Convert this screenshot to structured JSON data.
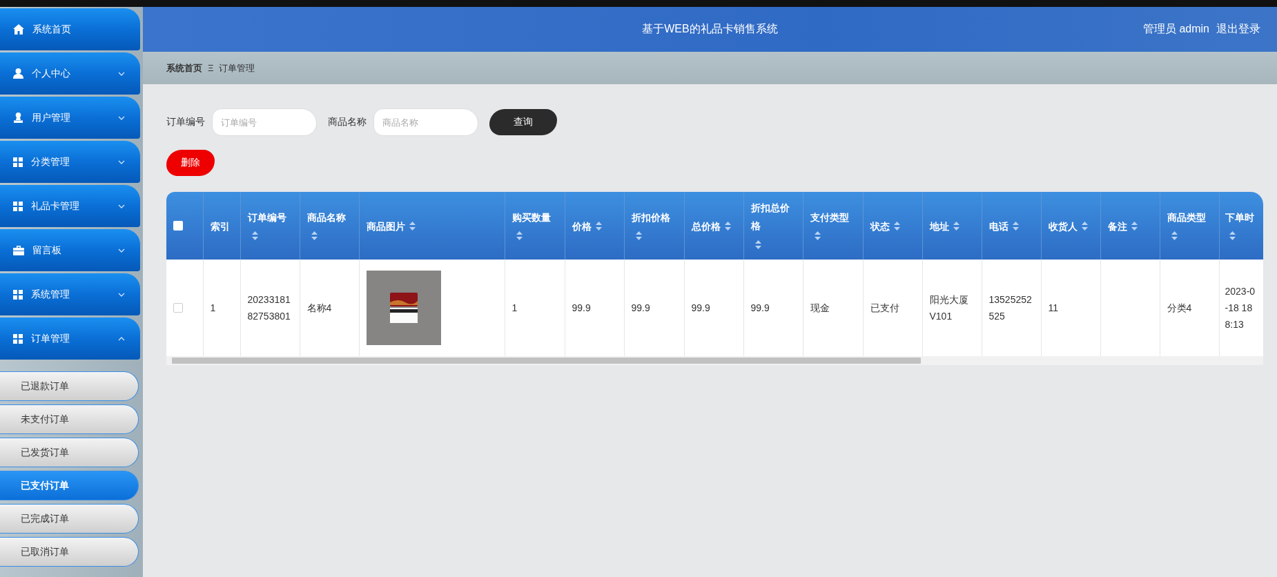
{
  "sidebar": {
    "items": [
      {
        "label": "系统首页",
        "kind": "link"
      },
      {
        "label": "个人中心",
        "kind": "menu",
        "expanded": false
      },
      {
        "label": "用户管理",
        "kind": "menu",
        "expanded": false
      },
      {
        "label": "分类管理",
        "kind": "menu",
        "expanded": false
      },
      {
        "label": "礼品卡管理",
        "kind": "menu",
        "expanded": false
      },
      {
        "label": "留言板",
        "kind": "menu",
        "expanded": false
      },
      {
        "label": "系统管理",
        "kind": "menu",
        "expanded": false
      },
      {
        "label": "订单管理",
        "kind": "menu",
        "expanded": true,
        "children": [
          {
            "label": "已退款订单",
            "selected": false
          },
          {
            "label": "未支付订单",
            "selected": false
          },
          {
            "label": "已发货订单",
            "selected": false
          },
          {
            "label": "已支付订单",
            "selected": true
          },
          {
            "label": "已完成订单",
            "selected": false
          },
          {
            "label": "已取消订单",
            "selected": false
          }
        ]
      }
    ]
  },
  "header": {
    "title": "基于WEB的礼品卡销售系统",
    "user": "管理员 admin",
    "logout": "退出登录"
  },
  "breadcrumb": [
    "系统首页",
    "订单管理"
  ],
  "breadcrumb_separator": "Ξ",
  "search": {
    "fields": [
      {
        "label": "订单编号",
        "placeholder": "订单编号"
      },
      {
        "label": "商品名称",
        "placeholder": "商品名称"
      }
    ],
    "button": "查询"
  },
  "delete_button": "删除",
  "table": {
    "select_all": {
      "checked": false
    },
    "columns": [
      {
        "label": "索引",
        "kind": "text",
        "sortable": false
      },
      {
        "label": "订单编号",
        "kind": "text",
        "sortable": true
      },
      {
        "label": "商品名称",
        "kind": "text",
        "sortable": true
      },
      {
        "label": "商品图片",
        "kind": "image",
        "sortable": true
      },
      {
        "label": "购买数量",
        "kind": "text",
        "sortable": true
      },
      {
        "label": "价格",
        "kind": "text",
        "sortable": true
      },
      {
        "label": "折扣价格",
        "kind": "text",
        "sortable": true
      },
      {
        "label": "总价格",
        "kind": "text",
        "sortable": true
      },
      {
        "label": "折扣总价格",
        "kind": "text",
        "sortable": true
      },
      {
        "label": "支付类型",
        "kind": "text",
        "sortable": true
      },
      {
        "label": "状态",
        "kind": "text",
        "sortable": true
      },
      {
        "label": "地址",
        "kind": "text",
        "sortable": true
      },
      {
        "label": "电话",
        "kind": "text",
        "sortable": true
      },
      {
        "label": "收货人",
        "kind": "text",
        "sortable": true
      },
      {
        "label": "备注",
        "kind": "text",
        "sortable": true
      },
      {
        "label": "商品类型",
        "kind": "text",
        "sortable": true
      },
      {
        "label": "下单时",
        "kind": "text",
        "sortable": true
      }
    ],
    "rows": [
      {
        "checked": false,
        "cells": [
          "1",
          "2023318182753801",
          "名称4",
          "",
          "1",
          "99.9",
          "99.9",
          "99.9",
          "99.9",
          "现金",
          "已支付",
          "阳光大厦V101",
          "13525252525",
          "11",
          "",
          "分类4",
          "2023-0\n-18 18\n8:13"
        ]
      }
    ]
  }
}
